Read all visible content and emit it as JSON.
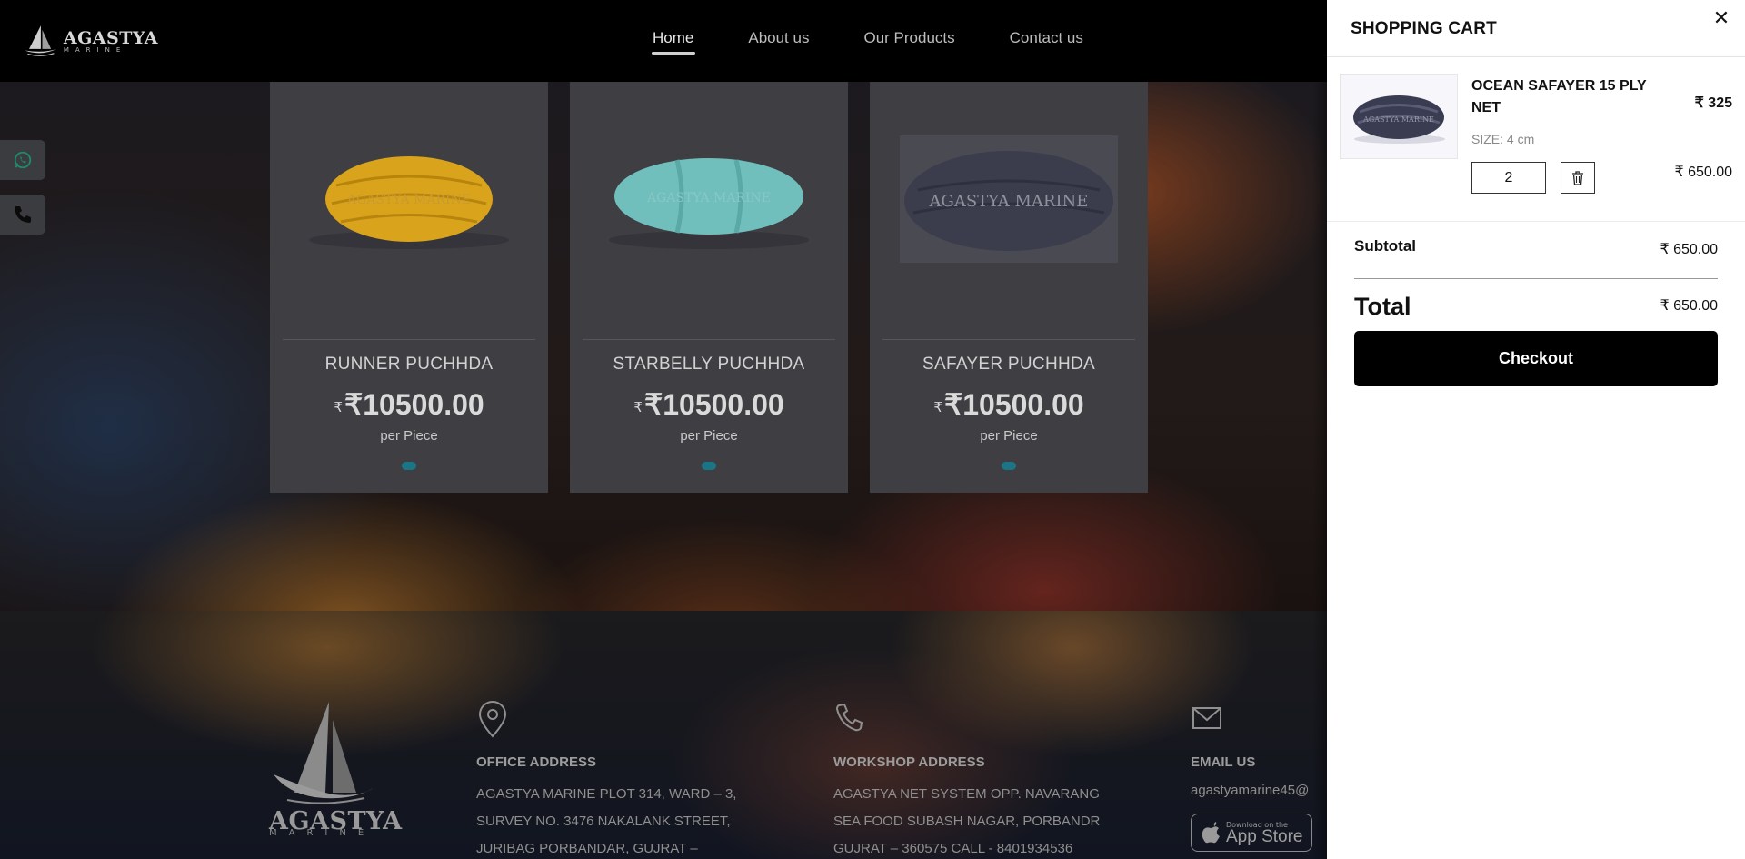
{
  "brand": {
    "name": "AGASTYA",
    "sub": "MARINE"
  },
  "nav": {
    "items": [
      {
        "label": "Home",
        "active": true
      },
      {
        "label": "About us"
      },
      {
        "label": "Our Products"
      },
      {
        "label": "Contact us"
      }
    ]
  },
  "floating": {
    "whatsapp_icon": "whatsapp-icon",
    "phone_icon": "phone-icon"
  },
  "products": [
    {
      "name": "RUNNER PUCHHDA",
      "currency": "₹",
      "price": "₹10500.00",
      "unit": "per Piece",
      "color": "#d9a41c",
      "watermark": "AGASTYA MARINE"
    },
    {
      "name": "STARBELLY PUCHHDA",
      "currency": "₹",
      "price": "₹10500.00",
      "unit": "per Piece",
      "color": "#71bfbd",
      "watermark": "AGASTYA MARINE"
    },
    {
      "name": "SAFAYER PUCHHDA",
      "currency": "₹",
      "price": "₹10500.00",
      "unit": "per Piece",
      "color": "#3b3d4d",
      "watermark": "AGASTYA MARINE"
    }
  ],
  "footer": {
    "office": {
      "title": "OFFICE ADDRESS",
      "lines": [
        "AGASTYA MARINE PLOT 314, WARD – 3,",
        "SURVEY NO. 3476 NAKALANK STREET,",
        "JURIBAG PORBANDAR, GUJRAT –"
      ]
    },
    "workshop": {
      "title": "WORKSHOP ADDRESS",
      "lines": [
        "AGASTYA NET SYSTEM OPP. NAVARANG",
        "SEA FOOD SUBASH NAGAR, PORBANDR",
        "GUJRAT – 360575 CALL - 8401934536"
      ]
    },
    "email": {
      "title": "EMAIL US",
      "address": "agastyamarine45@",
      "appstore_small": "Download on the",
      "appstore_big": "App Store"
    }
  },
  "cart": {
    "title": "SHOPPING CART",
    "close_label": "✕",
    "item": {
      "name": "OCEAN SAFAYER 15 PLY NET",
      "unit_price": "₹ 325",
      "size": "SIZE: 4 cm",
      "quantity": "2",
      "line_total": "₹ 650.00",
      "watermark": "AGASTYA MARINE"
    },
    "subtotal_label": "Subtotal",
    "subtotal_value": "₹ 650.00",
    "total_label": "Total",
    "total_value": "₹ 650.00",
    "checkout_label": "Checkout"
  }
}
